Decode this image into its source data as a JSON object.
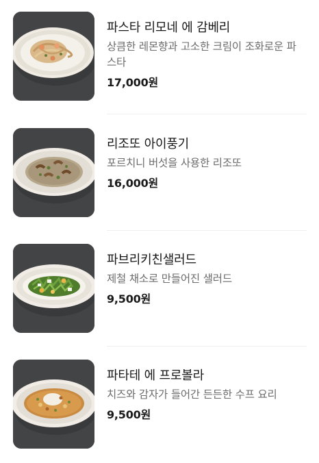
{
  "menu": {
    "items": [
      {
        "name": "파스타 리모네 에 감베리",
        "description": "상큼한 레몬향과 고소한 크림이 조화로운 파스타",
        "price": "17,000원"
      },
      {
        "name": "리조또 아이풍기",
        "description": "포르치니 버섯을 사용한 리조또",
        "price": "16,000원"
      },
      {
        "name": "파브리키친샐러드",
        "description": "제철 채소로 만들어진 샐러드",
        "price": "9,500원"
      },
      {
        "name": "파타테 에 프로볼라",
        "description": "치즈와 감자가 들어간 든든한 수프 요리",
        "price": "9,500원"
      }
    ]
  }
}
